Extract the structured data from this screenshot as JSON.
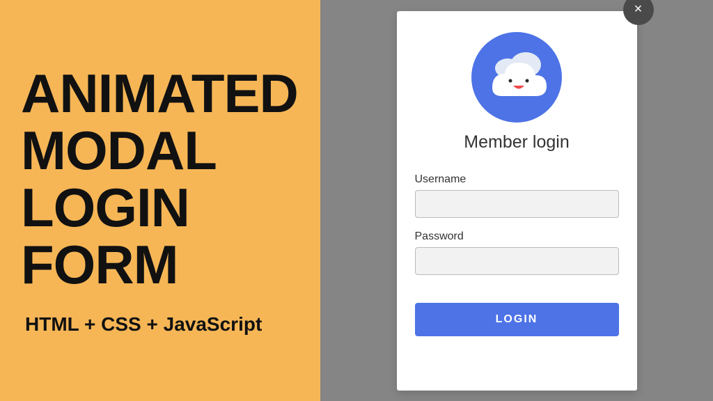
{
  "left": {
    "headline": "ANIMATED MODAL LOGIN FORM",
    "subheading": "HTML + CSS + JavaScript"
  },
  "modal": {
    "title": "Member login",
    "close_symbol": "×",
    "username_label": "Username",
    "password_label": "Password",
    "login_button": "LOGIN",
    "username_value": "",
    "password_value": ""
  }
}
